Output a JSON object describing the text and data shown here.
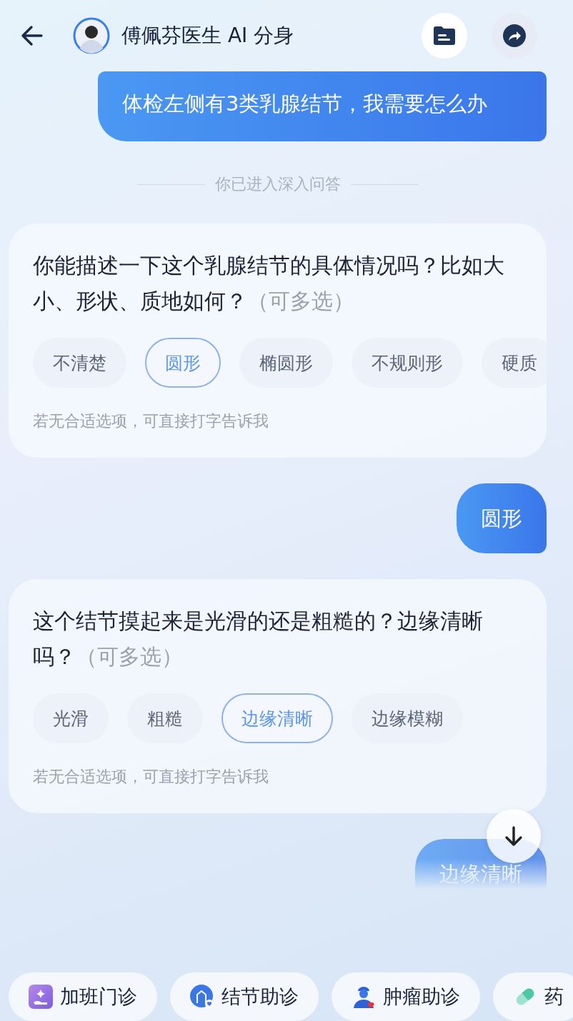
{
  "header": {
    "title": "傅佩芬医生 AI 分身"
  },
  "messages": [
    {
      "kind": "user",
      "text": "体检左侧有3类乳腺结节，我需要怎么办"
    },
    {
      "kind": "divider",
      "text": "你已进入深入问答"
    },
    {
      "kind": "question",
      "text": "你能描述一下这个乳腺结节的具体情况吗？比如大小、形状、质地如何？",
      "note": "（可多选）",
      "options": [
        {
          "label": "不清楚",
          "selected": false
        },
        {
          "label": "圆形",
          "selected": true
        },
        {
          "label": "椭圆形",
          "selected": false
        },
        {
          "label": "不规则形",
          "selected": false
        },
        {
          "label": "硬质",
          "selected": false
        }
      ],
      "footer": "若无合适选项，可直接打字告诉我"
    },
    {
      "kind": "user",
      "text": "圆形"
    },
    {
      "kind": "question",
      "text": "这个结节摸起来是光滑的还是粗糙的？边缘清晰吗？",
      "note": "（可多选）",
      "options": [
        {
          "label": "光滑",
          "selected": false
        },
        {
          "label": "粗糙",
          "selected": false
        },
        {
          "label": "边缘清晰",
          "selected": true
        },
        {
          "label": "边缘模糊",
          "selected": false
        }
      ],
      "footer": "若无合适选项，可直接打字告诉我"
    },
    {
      "kind": "user_fading",
      "text": "边缘清晰"
    }
  ],
  "quick_actions": [
    {
      "label": "加班门诊"
    },
    {
      "label": "结节助诊"
    },
    {
      "label": "肿瘤助诊"
    },
    {
      "label": "药"
    }
  ]
}
